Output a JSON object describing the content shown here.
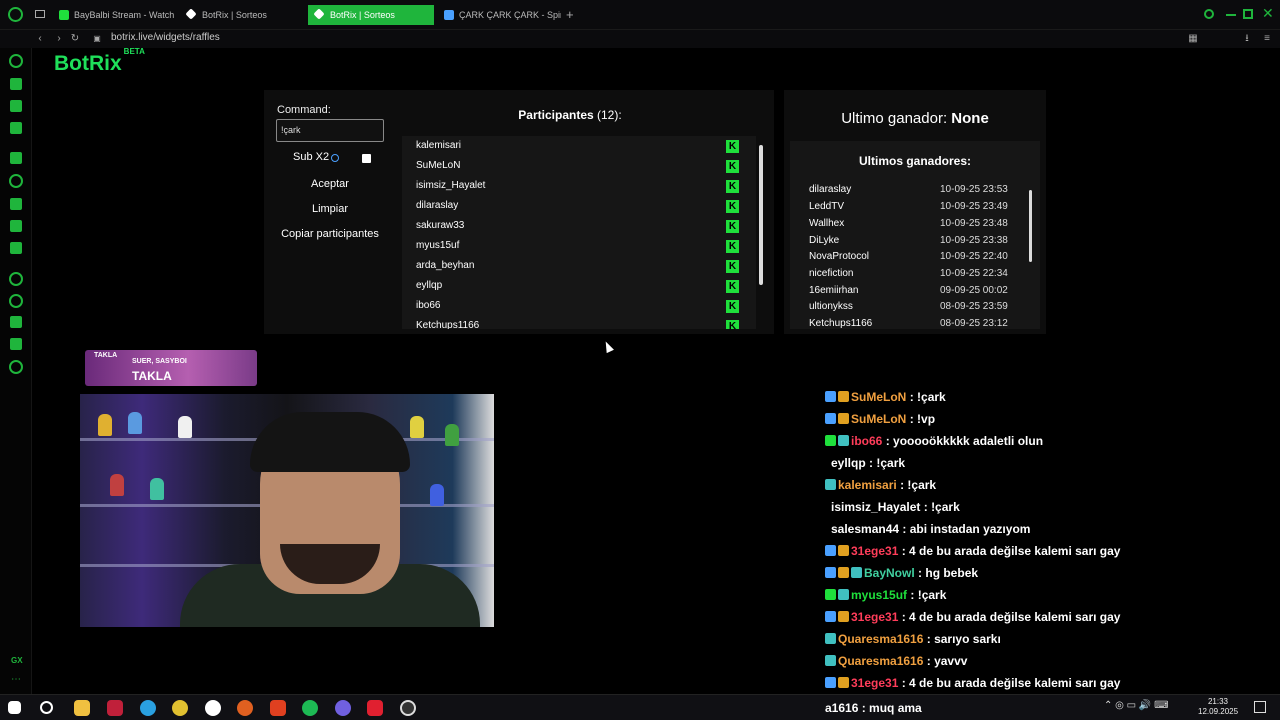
{
  "browser": {
    "tabs": [
      {
        "label": "BayBalbi Stream - Watch",
        "color": "#1fe03c"
      },
      {
        "label": "BotRix | Sorteos",
        "color": "#ffffff"
      },
      {
        "label": "BotRix | Sorteos",
        "color": "#ffffff"
      },
      {
        "label": "ÇARK ÇARK ÇARK - Spin",
        "color": "#4aa0ff"
      }
    ],
    "active_tab": 2,
    "url": "botrix.live/widgets/raffles"
  },
  "brand": {
    "name": "BotRix",
    "tag": "BETA"
  },
  "raffle": {
    "command_label": "Command:",
    "command_value": "!çark",
    "sub_label": "Sub X2",
    "accept": "Aceptar",
    "clear": "Limpiar",
    "copy": "Copiar participantes",
    "participants_title": "Participantes",
    "participants_count": "(12):",
    "participants": [
      "kalemisari",
      "SuMeLoN",
      "isimsiz_Hayalet",
      "dilaraslay",
      "sakuraw33",
      "myus15uf",
      "arda_beyhan",
      "eyllqp",
      "ibo66",
      "Ketchups1166"
    ]
  },
  "winners": {
    "last_label": "Ultimo ganador:",
    "last_value": "None",
    "list_title": "Ultimos ganadores:",
    "rows": [
      {
        "name": "dilaraslay",
        "date": "10-09-25 23:53"
      },
      {
        "name": "LeddTV",
        "date": "10-09-25 23:49"
      },
      {
        "name": "Wallhex",
        "date": "10-09-25 23:48"
      },
      {
        "name": "DiLyke",
        "date": "10-09-25 23:38"
      },
      {
        "name": "NovaProtocol",
        "date": "10-09-25 22:40"
      },
      {
        "name": "nicefiction",
        "date": "10-09-25 22:34"
      },
      {
        "name": "16emiirhan",
        "date": "09-09-25 00:02"
      },
      {
        "name": "ultionykss",
        "date": "08-09-25 23:59"
      },
      {
        "name": "Ketchups1166",
        "date": "08-09-25 23:12"
      }
    ]
  },
  "overlay": {
    "small": "TAKLA",
    "who": "SUER, SASYBOI",
    "big": "TAKLA"
  },
  "chat": [
    {
      "user": "SuMeLoN",
      "color": "#f0a040",
      "msg": ": !çark"
    },
    {
      "user": "SuMeLoN",
      "color": "#f0a040",
      "msg": ": !vp"
    },
    {
      "user": "ibo66",
      "color": "#ff3d5a",
      "msg": ": yooooökkkkk adaletli olun"
    },
    {
      "user": "eyllqp",
      "color": "#ffffff",
      "msg": ": !çark"
    },
    {
      "user": "kalemisari",
      "color": "#f0a040",
      "msg": ": !çark"
    },
    {
      "user": "isimsiz_Hayalet",
      "color": "#ffffff",
      "msg": ": !çark"
    },
    {
      "user": "salesman44",
      "color": "#ffffff",
      "msg": ": abi instadan yazıyom"
    },
    {
      "user": "31ege31",
      "color": "#ff3d5a",
      "msg": ": 4 de bu arada değilse kalemi sarı gay"
    },
    {
      "user": "BayNowl",
      "color": "#40d0a0",
      "msg": ": hg bebek"
    },
    {
      "user": "myus15uf",
      "color": "#1fe03c",
      "msg": ": !çark"
    },
    {
      "user": "31ege31",
      "color": "#ff3d5a",
      "msg": ": 4 de bu arada değilse kalemi sarı gay"
    },
    {
      "user": "Quaresma1616",
      "color": "#f0a040",
      "msg": ": sarıyo sarkı"
    },
    {
      "user": "Quaresma1616",
      "color": "#f0a040",
      "msg": ": yavvv"
    },
    {
      "user": "31ege31",
      "color": "#ff3d5a",
      "msg": ": 4 de bu arada değilse kalemi sarı gay"
    },
    {
      "user": "a1616",
      "color": "#ffffff",
      "msg": ": muq ama"
    }
  ],
  "taskbar": {
    "time": "21:33",
    "date": "12.09.2025"
  },
  "colors": {
    "accent": "#1fb53c",
    "kick_green": "#1fe03c"
  }
}
